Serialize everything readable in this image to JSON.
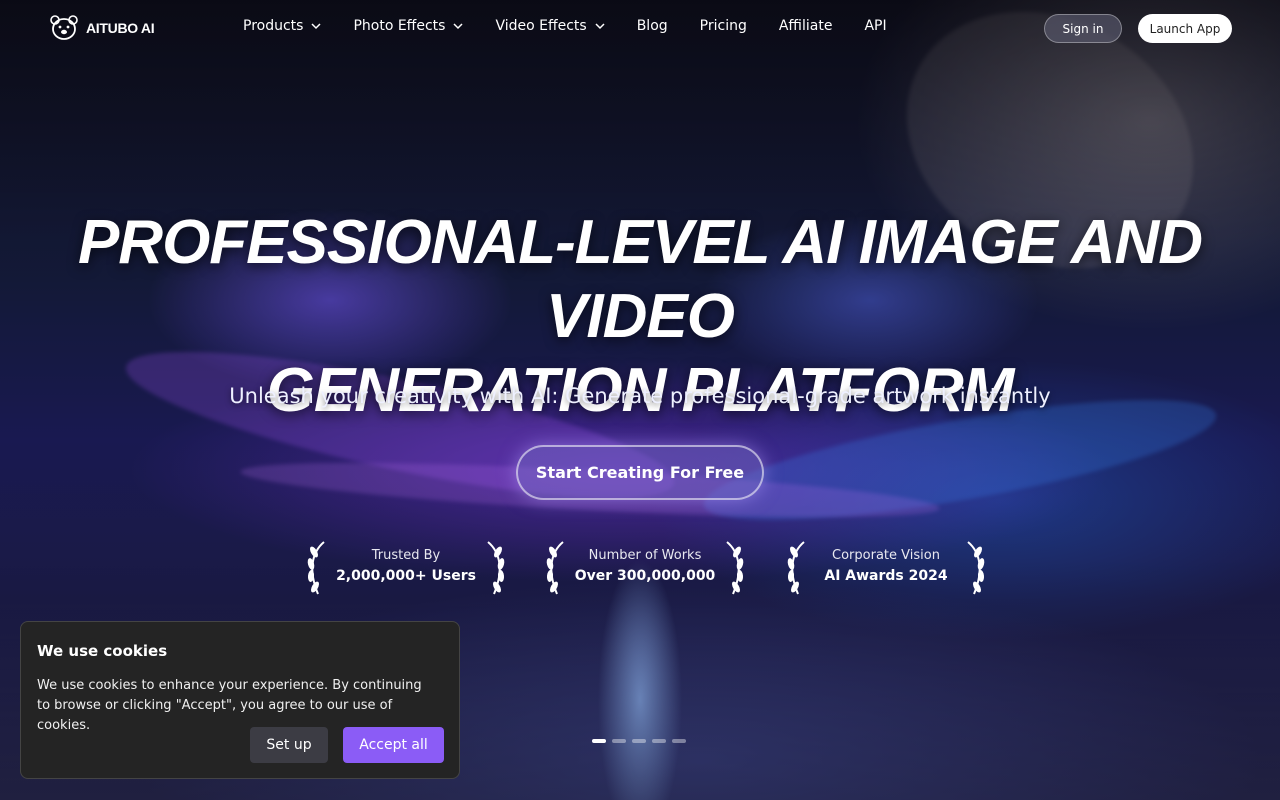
{
  "brand": {
    "name": "AITUBO AI"
  },
  "nav": {
    "items": [
      {
        "label": "Products",
        "dropdown": true
      },
      {
        "label": "Photo Effects",
        "dropdown": true
      },
      {
        "label": "Video Effects",
        "dropdown": true
      },
      {
        "label": "Blog",
        "dropdown": false
      },
      {
        "label": "Pricing",
        "dropdown": false
      },
      {
        "label": "Affiliate",
        "dropdown": false
      },
      {
        "label": "API",
        "dropdown": false
      }
    ],
    "signin_label": "Sign in",
    "launch_label": "Launch App"
  },
  "hero": {
    "title_line1": "PROFESSIONAL-LEVEL AI IMAGE AND VIDEO",
    "title_line2": "GENERATION PLATFORM",
    "subtitle": "Unleash your creativity with AI: Generate professional-grade artwork instantly",
    "cta_label": "Start Creating For Free"
  },
  "awards": [
    {
      "label": "Trusted By",
      "value": "2,000,000+ Users"
    },
    {
      "label": "Number of Works",
      "value": "Over 300,000,000"
    },
    {
      "label": "Corporate Vision",
      "value": "AI Awards 2024"
    }
  ],
  "carousel": {
    "total": 5,
    "active_index": 0
  },
  "cookie": {
    "title": "We use cookies",
    "text": "We use cookies to enhance your experience. By continuing to browse or clicking \"Accept\", you agree to our use of cookies.",
    "setup_label": "Set up",
    "accept_label": "Accept all"
  },
  "colors": {
    "accent": "#8b5cf6",
    "cookie_bg": "#242424"
  }
}
